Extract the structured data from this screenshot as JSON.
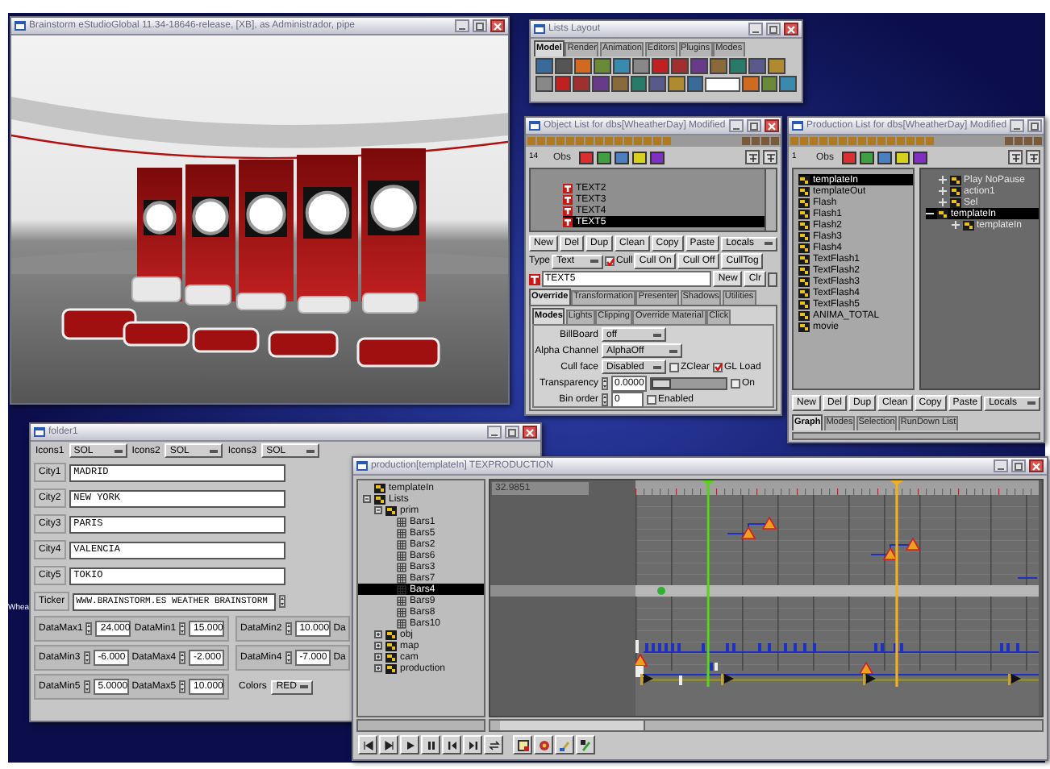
{
  "desktop": {
    "icon_label": "Whea"
  },
  "viewer": {
    "title": "Brainstorm eStudioGlobal 11.34-18646-release, [XB], as Administrador, pipe"
  },
  "lists_layout": {
    "title": "Lists Layout",
    "tabs": [
      {
        "label": "Model",
        "selected": true
      },
      {
        "label": "Render",
        "selected": false
      },
      {
        "label": "Animation",
        "selected": false
      },
      {
        "label": "Editors",
        "selected": false
      },
      {
        "label": "Plugins",
        "selected": false
      },
      {
        "label": "Modes",
        "selected": false
      }
    ]
  },
  "object_list": {
    "title": "Object List for dbs[WheatherDay] Modified",
    "count": "14",
    "obs_label": "Obs",
    "tree": [
      {
        "label": "TEXT2",
        "selected": false
      },
      {
        "label": "TEXT3",
        "selected": false
      },
      {
        "label": "TEXT4",
        "selected": false
      },
      {
        "label": "TEXT5",
        "selected": true
      }
    ],
    "buttons": [
      "New",
      "Del",
      "Dup",
      "Clean",
      "Copy",
      "Paste"
    ],
    "locals": "Locals",
    "type": {
      "label": "Type",
      "value": "Text"
    },
    "cull": {
      "label": "Cull",
      "checked": true
    },
    "cull_buttons": [
      "Cull On",
      "Cull Off",
      "CullTog"
    ],
    "name_field": {
      "value": "TEXT5",
      "buttons": [
        "New",
        "Clr"
      ]
    },
    "tabs": [
      {
        "label": "Override",
        "selected": true
      },
      {
        "label": "Transformation",
        "selected": false
      },
      {
        "label": "Presenter",
        "selected": false
      },
      {
        "label": "Shadows",
        "selected": false
      },
      {
        "label": "Utilities",
        "selected": false
      }
    ],
    "subtabs": [
      {
        "label": "Modes",
        "selected": true
      },
      {
        "label": "Lights",
        "selected": false
      },
      {
        "label": "Clipping",
        "selected": false
      },
      {
        "label": "Override Material",
        "selected": false
      },
      {
        "label": "Click",
        "selected": false
      }
    ],
    "fields": [
      {
        "kind": "dropdown",
        "label": "BillBoard",
        "value": "off"
      },
      {
        "kind": "dropdown",
        "label": "Alpha Channel",
        "value": "AlphaOff"
      },
      {
        "kind": "dropdown",
        "label": "Cull face",
        "value": "Disabled",
        "checks": [
          {
            "label": "ZClear",
            "checked": false
          },
          {
            "label": "GL Load",
            "checked": true
          }
        ]
      },
      {
        "kind": "slider",
        "label": "Transparency",
        "value": "0.0000",
        "level": 0,
        "checks": [
          {
            "label": "On",
            "checked": false
          }
        ]
      },
      {
        "kind": "spin",
        "label": "Bin order",
        "value": "0",
        "checks": [
          {
            "label": "Enabled",
            "checked": false
          }
        ]
      }
    ]
  },
  "production_list": {
    "title": "Production List for dbs[WheatherDay] Modified",
    "count": "1",
    "obs_label": "Obs",
    "items": [
      {
        "label": "templateIn",
        "selected": true
      },
      {
        "label": "templateOut",
        "selected": false
      },
      {
        "label": "Flash",
        "selected": false
      },
      {
        "label": "Flash1",
        "selected": false
      },
      {
        "label": "Flash2",
        "selected": false
      },
      {
        "label": "Flash3",
        "selected": false
      },
      {
        "label": "Flash4",
        "selected": false
      },
      {
        "label": "TextFlash1",
        "selected": false
      },
      {
        "label": "TextFlash2",
        "selected": false
      },
      {
        "label": "TextFlash3",
        "selected": false
      },
      {
        "label": "TextFlash4",
        "selected": false
      },
      {
        "label": "TextFlash5",
        "selected": false
      },
      {
        "label": "ANIMA_TOTAL",
        "selected": false
      },
      {
        "label": "movie",
        "selected": false
      }
    ],
    "tree": [
      {
        "label": "Play NoPause",
        "selected": false,
        "expanded": false
      },
      {
        "label": "action1",
        "selected": false,
        "expanded": false
      },
      {
        "label": "Sel",
        "selected": false,
        "expanded": false
      },
      {
        "label": "templateIn",
        "selected": true,
        "expanded": true,
        "children": [
          {
            "label": "templateIn",
            "selected": false,
            "expanded": false
          }
        ]
      }
    ],
    "buttons": [
      "New",
      "Del",
      "Dup",
      "Clean",
      "Copy",
      "Paste"
    ],
    "locals": "Locals",
    "tabs": [
      {
        "label": "Graph",
        "selected": true
      },
      {
        "label": "Modes",
        "selected": false
      },
      {
        "label": "Selection",
        "selected": false
      },
      {
        "label": "RunDown List",
        "selected": false
      }
    ]
  },
  "folder": {
    "title": "folder1",
    "icon_selectors": [
      {
        "label": "Icons1",
        "value": "SOL"
      },
      {
        "label": "Icons2",
        "value": "SOL"
      },
      {
        "label": "Icons3",
        "value": "SOL"
      }
    ],
    "cities": [
      {
        "label": "City1",
        "value": "MADRID"
      },
      {
        "label": "City2",
        "value": "NEW YORK"
      },
      {
        "label": "City3",
        "value": "PARIS"
      },
      {
        "label": "City4",
        "value": "VALENCIA"
      },
      {
        "label": "City5",
        "value": "TOKIO"
      }
    ],
    "ticker": {
      "label": "Ticker",
      "value": "WWW.BRAINSTORM.ES WEATHER BRAINSTORM"
    },
    "data_groups": [
      {
        "fields": [
          {
            "label": "DataMax1",
            "value": "24.000"
          },
          {
            "label": "DataMin1",
            "value": "15.000"
          }
        ]
      },
      {
        "fields": [
          {
            "label": "DataMin2",
            "value": "10.000"
          },
          {
            "label": "Da"
          }
        ]
      },
      {
        "fields": [
          {
            "label": "DataMin3",
            "value": "-6.000"
          },
          {
            "label": "DataMax4",
            "value": "-2.000"
          }
        ]
      },
      {
        "fields": [
          {
            "label": "DataMin4",
            "value": "-7.000"
          },
          {
            "label": "Da"
          }
        ]
      },
      {
        "fields": [
          {
            "label": "DataMin5",
            "value": "5.0000"
          },
          {
            "label": "DataMax5",
            "value": "10.000"
          }
        ]
      }
    ],
    "colors": {
      "label": "Colors",
      "value": "RED"
    }
  },
  "timeline": {
    "title": "production[templateIn] TEXPRODUCTION",
    "time": "32.9851",
    "tree": [
      {
        "label": "templateIn",
        "selected": false
      },
      {
        "label": "Lists",
        "selected": false,
        "expanded": true,
        "children": [
          {
            "label": "prim",
            "selected": false,
            "expanded": true,
            "children": [
              {
                "label": "Bars1",
                "selected": false
              },
              {
                "label": "Bars5",
                "selected": false
              },
              {
                "label": "Bars2",
                "selected": false
              },
              {
                "label": "Bars6",
                "selected": false
              },
              {
                "label": "Bars3",
                "selected": false
              },
              {
                "label": "Bars7",
                "selected": false
              },
              {
                "label": "Bars4",
                "selected": true
              },
              {
                "label": "Bars9",
                "selected": false
              },
              {
                "label": "Bars8",
                "selected": false
              },
              {
                "label": "Bars10",
                "selected": false
              }
            ]
          },
          {
            "label": "obj",
            "selected": false,
            "expanded": false
          },
          {
            "label": "map",
            "selected": false,
            "expanded": false
          },
          {
            "label": "cam",
            "selected": false,
            "expanded": false
          },
          {
            "label": "production",
            "selected": false,
            "expanded": false
          }
        ]
      }
    ]
  }
}
